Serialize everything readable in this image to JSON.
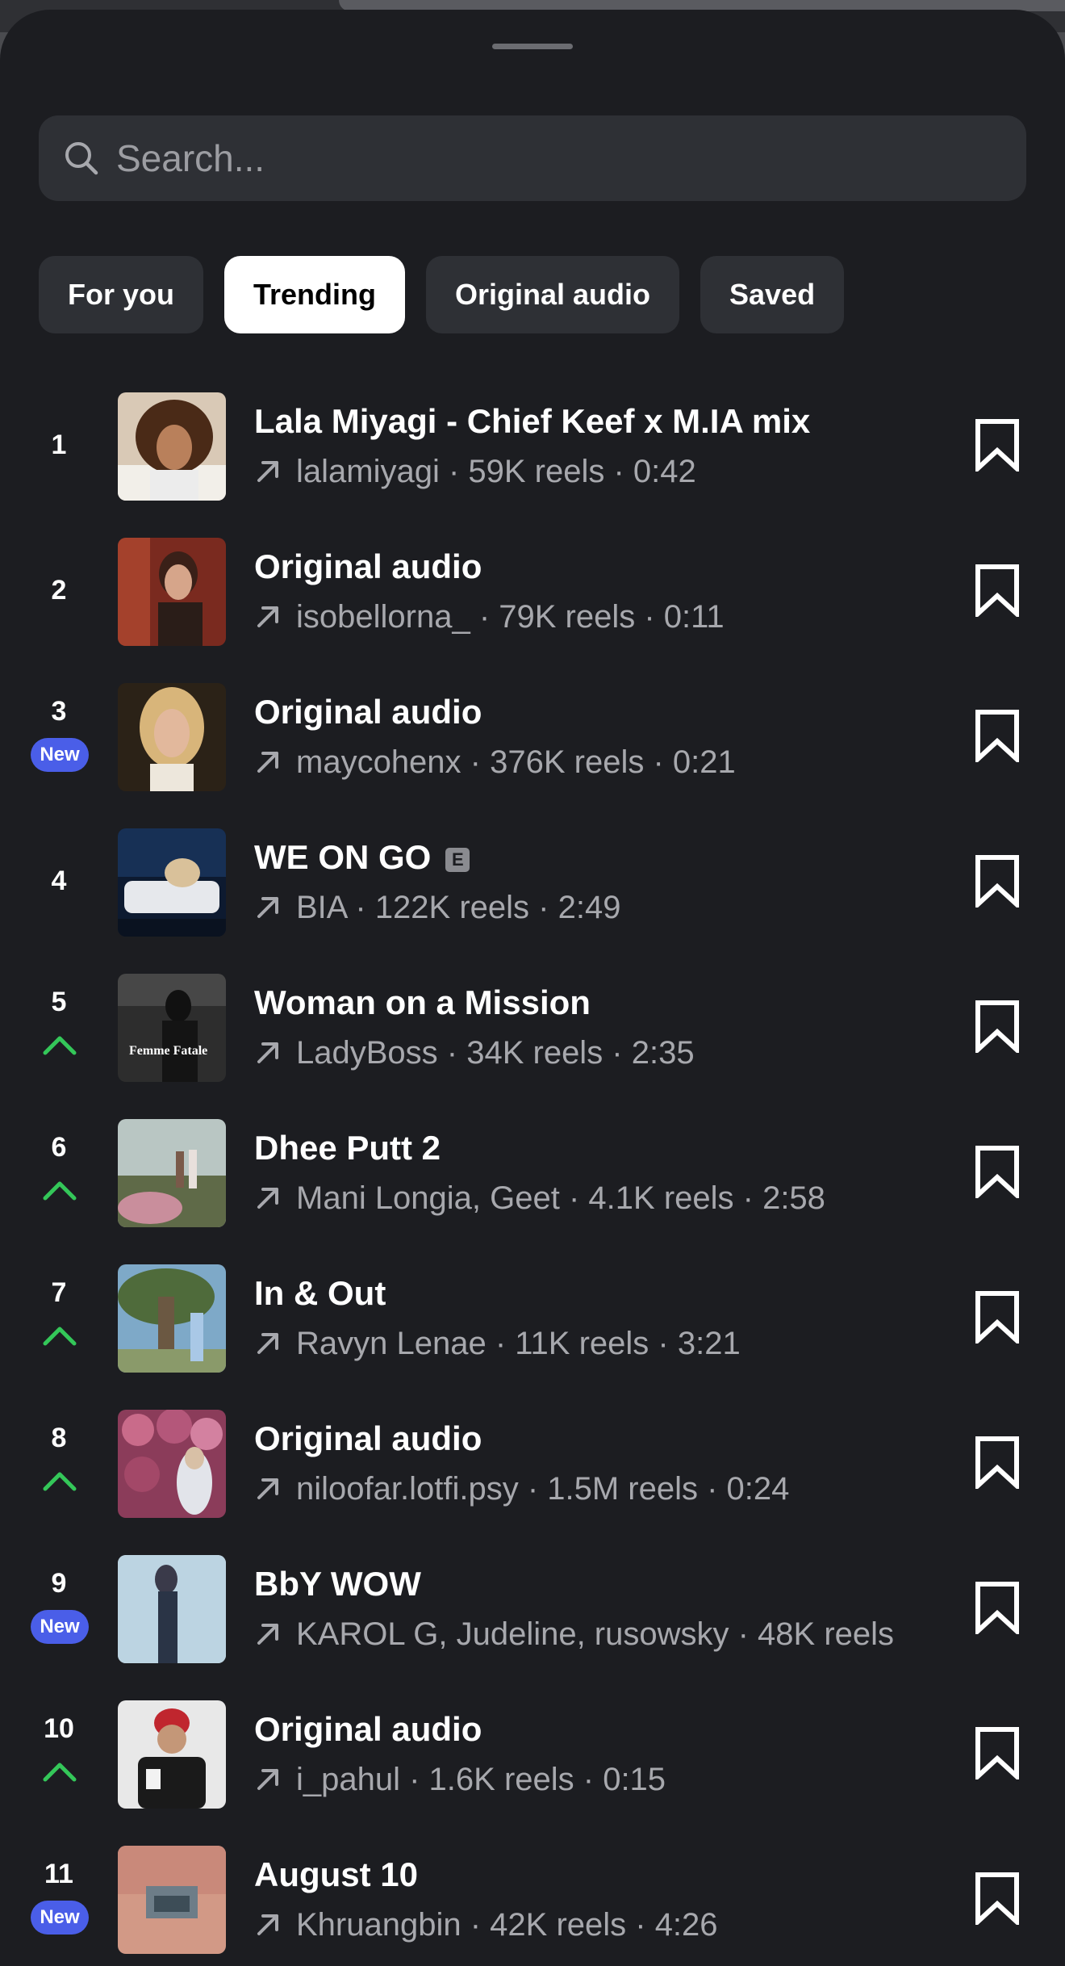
{
  "search": {
    "placeholder": "Search..."
  },
  "tabs": [
    {
      "label": "For you",
      "active": false
    },
    {
      "label": "Trending",
      "active": true
    },
    {
      "label": "Original audio",
      "active": false
    },
    {
      "label": "Saved",
      "active": false
    }
  ],
  "tracks": [
    {
      "rank": "1",
      "status": "none",
      "title": "Lala Miyagi - Chief Keef x M.IA mix",
      "explicit": false,
      "subtitle": "lalamiyagi · 59K reels · 0:42"
    },
    {
      "rank": "2",
      "status": "none",
      "title": "Original audio",
      "explicit": false,
      "subtitle": "isobellorna_ · 79K reels · 0:11"
    },
    {
      "rank": "3",
      "status": "new",
      "badge": "New",
      "title": "Original audio",
      "explicit": false,
      "subtitle": "maycohenx · 376K reels · 0:21"
    },
    {
      "rank": "4",
      "status": "none",
      "title": "WE ON GO",
      "explicit": true,
      "explicit_label": "E",
      "subtitle": "BIA · 122K reels · 2:49"
    },
    {
      "rank": "5",
      "status": "up",
      "title": "Woman on a Mission",
      "explicit": false,
      "subtitle": "LadyBoss · 34K reels · 2:35"
    },
    {
      "rank": "6",
      "status": "up",
      "title": "Dhee Putt 2",
      "explicit": false,
      "subtitle": "Mani Longia, Geet · 4.1K reels · 2:58"
    },
    {
      "rank": "7",
      "status": "up",
      "title": "In & Out",
      "explicit": false,
      "subtitle": "Ravyn Lenae · 11K reels · 3:21"
    },
    {
      "rank": "8",
      "status": "up",
      "title": "Original audio",
      "explicit": false,
      "subtitle": "niloofar.lotfi.psy · 1.5M reels · 0:24"
    },
    {
      "rank": "9",
      "status": "new",
      "badge": "New",
      "title": "BbY WOW",
      "explicit": false,
      "subtitle": "KAROL G, Judeline, rusowsky · 48K reels"
    },
    {
      "rank": "10",
      "status": "up",
      "title": "Original audio",
      "explicit": false,
      "subtitle": "i_pahul · 1.6K reels · 0:15"
    },
    {
      "rank": "11",
      "status": "new",
      "badge": "New",
      "title": "August 10",
      "explicit": false,
      "subtitle": "Khruangbin · 42K reels · 4:26"
    }
  ],
  "colors": {
    "background": "#1c1d21",
    "chip": "#2e3035",
    "new_badge": "#4a5ee8",
    "trend_up": "#34c759",
    "subtext": "#a7a8ad"
  },
  "icons": {
    "search": "search-icon",
    "trend": "arrow-up-right-icon",
    "save": "bookmark-icon",
    "rank_up": "chevron-up-icon"
  }
}
